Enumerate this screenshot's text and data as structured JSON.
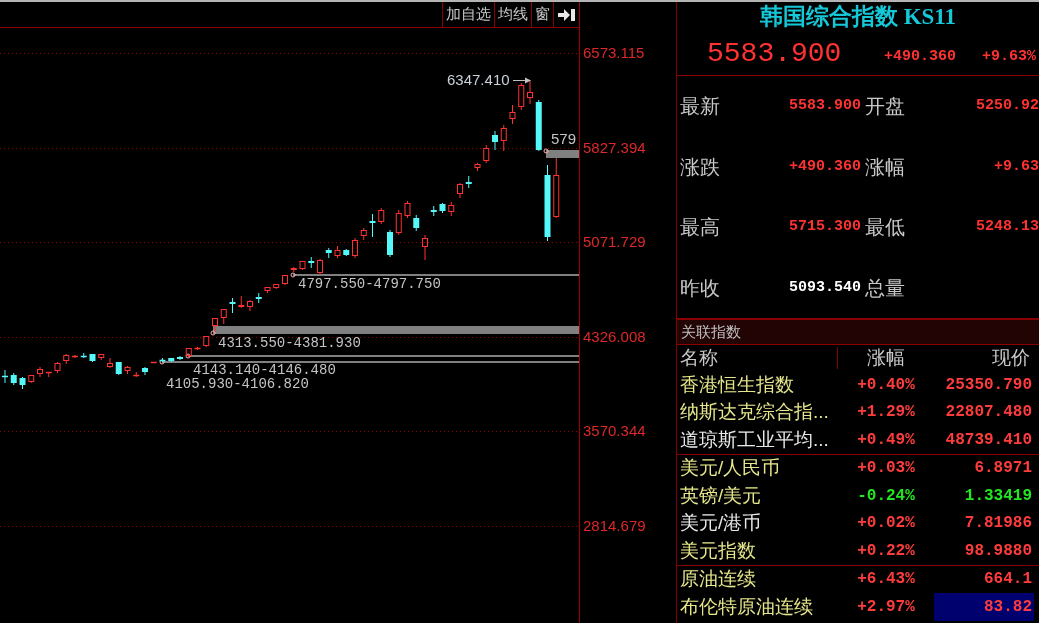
{
  "toolbar": {
    "buttons": [
      "加自选",
      "均线",
      "窗"
    ]
  },
  "chart": {
    "price_axis": [
      "6573.115",
      "5827.394",
      "5071.729",
      "4326.008",
      "3570.344",
      "2814.679"
    ],
    "high_marker": "6347.410",
    "last_price_tag": "579",
    "gap_labels": [
      "4797.550-4797.750",
      "4313.550-4381.930",
      "4143.140-4146.480",
      "4105.930-4106.820"
    ]
  },
  "quote": {
    "title": "韩国综合指数 KS11",
    "price": "5583.900",
    "change": "+490.360",
    "change_percent": "+9.63%",
    "stats": [
      {
        "label": "最新",
        "value": "5583.900",
        "color": "#ff3232"
      },
      {
        "label": "开盘",
        "value": "5250.92",
        "color": "#ff3232"
      },
      {
        "label": "涨跌",
        "value": "+490.360",
        "color": "#ff3232"
      },
      {
        "label": "涨幅",
        "value": "+9.63",
        "color": "#ff3232"
      },
      {
        "label": "最高",
        "value": "5715.300",
        "color": "#ff3232"
      },
      {
        "label": "最低",
        "value": "5248.13",
        "color": "#ff3232"
      },
      {
        "label": "昨收",
        "value": "5093.540",
        "color": "#ffffff"
      },
      {
        "label": "总量"
      }
    ]
  },
  "related": {
    "title": "关联指数",
    "columns": [
      "名称",
      "涨幅",
      "现价"
    ],
    "groups": [
      {
        "rows": [
          {
            "name": "香港恒生指数",
            "color": "#e6e68c",
            "change": "+0.40%",
            "price": "25350.790",
            "falling": false,
            "selected": false
          },
          {
            "name": "纳斯达克综合指...",
            "color": "#e6e68c",
            "change": "+1.29%",
            "price": "22807.480",
            "falling": false,
            "selected": false
          },
          {
            "name": "道琼斯工业平均...",
            "color": "#e8e8e8",
            "change": "+0.49%",
            "price": "48739.410",
            "falling": false,
            "selected": false
          }
        ]
      },
      {
        "rows": [
          {
            "name": "美元/人民币",
            "color": "#e6e68c",
            "change": "+0.03%",
            "price": "6.8971",
            "falling": false,
            "selected": false
          },
          {
            "name": "英镑/美元",
            "color": "#e6e68c",
            "change": "-0.24%",
            "price": "1.33419",
            "falling": true,
            "selected": false
          },
          {
            "name": "美元/港币",
            "color": "#e8e8e8",
            "change": "+0.02%",
            "price": "7.81986",
            "falling": false,
            "selected": false
          },
          {
            "name": "美元指数",
            "color": "#e6e68c",
            "change": "+0.22%",
            "price": "98.9880",
            "falling": false,
            "selected": false
          }
        ]
      },
      {
        "rows": [
          {
            "name": "原油连续",
            "color": "#e6e68c",
            "change": "+6.43%",
            "price": "664.1",
            "falling": false,
            "selected": false
          },
          {
            "name": "布伦特原油连续",
            "color": "#e6e68c",
            "change": "+2.97%",
            "price": "83.82",
            "falling": false,
            "selected": true
          }
        ]
      }
    ]
  }
}
